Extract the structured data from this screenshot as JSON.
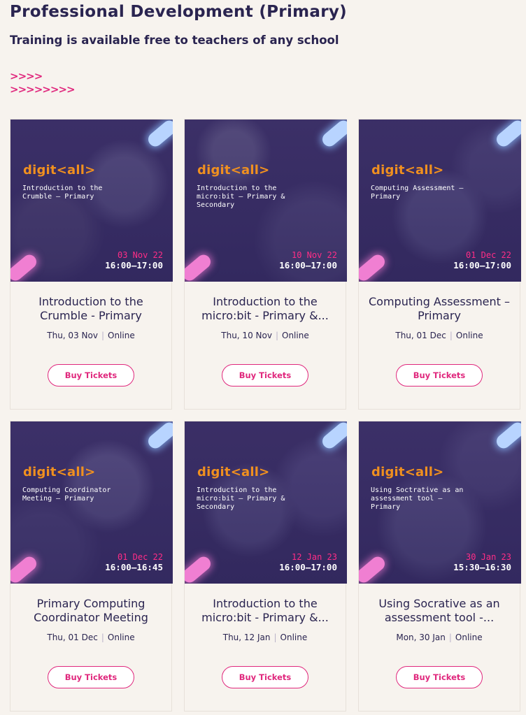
{
  "header": {
    "title": "Professional Development (Primary)",
    "subtitle": "Training is available free to teachers of any school",
    "chevrons_1": ">>>>",
    "chevrons_2": ">>>>>>>>"
  },
  "brand": {
    "logo_text": "digit<all>",
    "accent_pink": "#e0287d",
    "accent_orange": "#f0901f"
  },
  "cards": [
    {
      "thumb_label": "Introduction to the Crumble – Primary",
      "thumb_date": "03 Nov 22",
      "thumb_time": "16:00–17:00",
      "title": "Introduction to the Crumble - Primary",
      "date": "Thu, 03 Nov",
      "location": "Online",
      "button": "Buy Tickets"
    },
    {
      "thumb_label": "Introduction to the micro:bit – Primary & Secondary",
      "thumb_date": "10 Nov 22",
      "thumb_time": "16:00–17:00",
      "title": "Introduction to the micro:bit - Primary &...",
      "date": "Thu, 10 Nov",
      "location": "Online",
      "button": "Buy Tickets"
    },
    {
      "thumb_label": "Computing Assessment – Primary",
      "thumb_date": "01 Dec 22",
      "thumb_time": "16:00–17:00",
      "title": "Computing Assessment – Primary",
      "date": "Thu, 01 Dec",
      "location": "Online",
      "button": "Buy Tickets"
    },
    {
      "thumb_label": "Computing Coordinator Meeting – Primary",
      "thumb_date": "01 Dec 22",
      "thumb_time": "16:00–16:45",
      "title": "Primary Computing Coordinator Meeting",
      "date": "Thu, 01 Dec",
      "location": "Online",
      "button": "Buy Tickets"
    },
    {
      "thumb_label": "Introduction to the micro:bit – Primary & Secondary",
      "thumb_date": "12 Jan 23",
      "thumb_time": "16:00–17:00",
      "title": "Introduction to the micro:bit - Primary &...",
      "date": "Thu, 12 Jan",
      "location": "Online",
      "button": "Buy Tickets"
    },
    {
      "thumb_label": "Using Soctrative as an assessment tool – Primary",
      "thumb_date": "30 Jan 23",
      "thumb_time": "15:30–16:30",
      "title": "Using Socrative as an assessment tool -...",
      "date": "Mon, 30 Jan",
      "location": "Online",
      "button": "Buy Tickets"
    }
  ]
}
